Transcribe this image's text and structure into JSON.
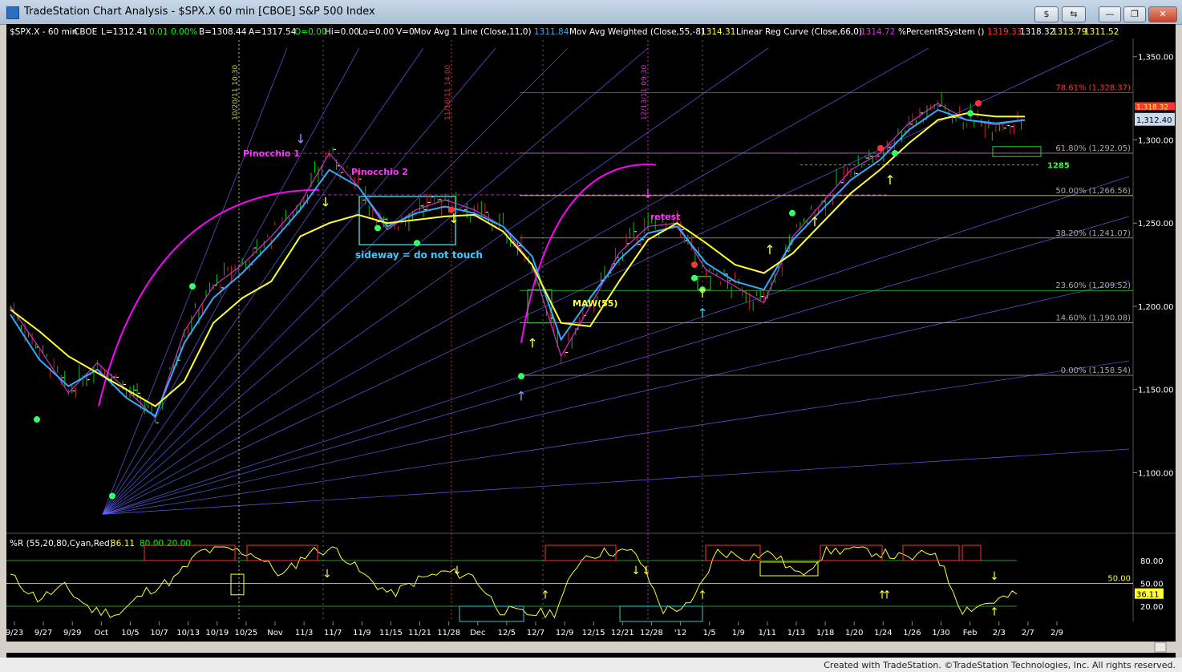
{
  "window": {
    "title": "TradeStation Chart Analysis - $SPX.X 60 min [CBOE] S&P 500 Index",
    "buttons": [
      "$",
      "⇆",
      "—",
      "❐",
      "✕"
    ]
  },
  "header": {
    "symbol": "$SPX.X - 60 min",
    "exchange": "CBOE",
    "last": "L=1312.41",
    "change": "0.01",
    "pct": "0.00%",
    "bid": "B=1308.44",
    "ask": "A=1317.54",
    "open": "O=0.00",
    "hi": "Hi=0.00",
    "lo": "Lo=0.00",
    "vol": "V=0",
    "ind1": "Mov Avg 1 Line (Close,11,0)",
    "ind1_val": "1311.84",
    "ind2": "Mov Avg Weighted (Close,55,-8)",
    "ind2_val": "1314.31",
    "ind3": "Linear Reg Curve (Close,66,0)",
    "ind3_val": "1314.72",
    "ind4": "%PercentRSystem ()",
    "ind4_v1": "1319.33",
    "ind4_v2": "1318.32",
    "ind4_v3": "1313.79",
    "ind4_v4": "1311.52"
  },
  "colors": {
    "background": "#000000",
    "price_bars": "#00c800",
    "ma11": "#33a8ff",
    "maw55": "#ffff33",
    "linreg": "#cc33cc",
    "arc": "#ff00ff",
    "fan": "#6666ff",
    "fib": "#aaaaaa",
    "fib_label": "#aaaaaa",
    "red_level": "#ff3333",
    "cyan": "#33cccc",
    "osc_line": "#ffff33",
    "osc_high": "#ff3333",
    "osc_low": "#33cccc"
  },
  "chart_data": {
    "type": "line",
    "title": "$SPX.X 60 min [CBOE] S&P 500 Index",
    "x": [
      "9/23",
      "9/27",
      "9/29",
      "Oct",
      "10/5",
      "10/7",
      "10/13",
      "10/19",
      "10/25",
      "Nov",
      "11/3",
      "11/7",
      "11/9",
      "11/15",
      "11/21",
      "11/28",
      "Dec",
      "12/5",
      "12/7",
      "12/9",
      "12/15",
      "12/21",
      "12/28",
      "'12",
      "1/5",
      "1/9",
      "1/11",
      "1/13",
      "1/18",
      "1/20",
      "1/24",
      "1/26",
      "1/30",
      "Feb"
    ],
    "x_ticks": [
      "9/23",
      "9/27",
      "9/29",
      "Oct",
      "10/5",
      "10/7",
      "10/13",
      "10/19",
      "10/25",
      "Nov",
      "11/3",
      "11/7",
      "11/9",
      "11/15",
      "11/21",
      "11/28",
      "Dec",
      "12/5",
      "12/7",
      "12/9",
      "12/15",
      "12/21",
      "12/28",
      "'12",
      "1/5",
      "1/9",
      "1/11",
      "1/13",
      "1/18",
      "1/20",
      "1/24",
      "1/26",
      "1/30",
      "Feb",
      "2/3",
      "2/7",
      "2/9"
    ],
    "y_ticks": [
      "1,350.00",
      "1,300.00",
      "1,250.00",
      "1,200.00",
      "1,150.00",
      "1,100.00"
    ],
    "y_tick_values": [
      1350,
      1300,
      1250,
      1200,
      1150,
      1100
    ],
    "ylim": [
      1066,
      1360
    ],
    "series": [
      {
        "values": [
          1200,
          1175,
          1148,
          1166,
          1150,
          1133,
          1185,
          1212,
          1225,
          1242,
          1262,
          1292,
          1272,
          1246,
          1258,
          1264,
          1258,
          1248,
          1225,
          1170,
          1200,
          1232,
          1248,
          1250,
          1222,
          1212,
          1202,
          1242,
          1262,
          1282,
          1292,
          1310,
          1322,
          1312,
          1309,
          1312
        ]
      },
      {
        "values": [
          1195,
          1168,
          1152,
          1162,
          1145,
          1134,
          1178,
          1205,
          1220,
          1238,
          1258,
          1282,
          1272,
          1248,
          1256,
          1260,
          1256,
          1248,
          1230,
          1180,
          1205,
          1228,
          1244,
          1248,
          1226,
          1215,
          1210,
          1240,
          1258,
          1276,
          1288,
          1306,
          1318,
          1312,
          1310,
          1312
        ]
      },
      {
        "values": [
          1198,
          1185,
          1170,
          1160,
          1150,
          1140,
          1155,
          1190,
          1205,
          1215,
          1242,
          1250,
          1255,
          1250,
          1252,
          1254,
          1255,
          1245,
          1225,
          1190,
          1188,
          1215,
          1240,
          1250,
          1238,
          1225,
          1220,
          1232,
          1250,
          1268,
          1282,
          1298,
          1312,
          1316,
          1314,
          1314
        ]
      }
    ],
    "price_last": "1,312.40",
    "price_marker2": "1,318.32",
    "fib_levels": [
      {
        "label": "78.61% (1,328.37)",
        "value": 1328.37
      },
      {
        "label": "61.80% (1,292.05)",
        "value": 1292.05
      },
      {
        "label": "50.00% (1,266.56)",
        "value": 1266.56
      },
      {
        "label": "38.20% (1,241.07)",
        "value": 1241.07
      },
      {
        "label": "23.60% (1,209.52)",
        "value": 1209.52
      },
      {
        "label": "14.60% (1,190.08)",
        "value": 1190.08
      },
      {
        "label": "0.00% (1,158.54)",
        "value": 1158.54
      }
    ],
    "level_1285": {
      "label": "1285",
      "value": 1285
    },
    "vertical_dates": [
      "10/20/11 10:30",
      "11/16/11 14:00",
      "12/13/11 09:30"
    ],
    "annotations": [
      "Pinocchio 1",
      "Pinocchio 2",
      "sideway = do not touch",
      "retest",
      "MAW(55)"
    ],
    "oscillator": {
      "title": "%R (55,20,80,Cyan,Red)",
      "value": "36.11",
      "upper": "80.00",
      "lower": "20.00",
      "current_label": "36.11",
      "mid_label": "50.00",
      "y_ticks": [
        "80.00",
        "50.00",
        "20.00"
      ],
      "ylim": [
        0,
        100
      ],
      "values": [
        60,
        30,
        45,
        15,
        10,
        40,
        55,
        92,
        95,
        88,
        60,
        92,
        95,
        60,
        35,
        55,
        65,
        60,
        15,
        10,
        12,
        85,
        92,
        90,
        15,
        20,
        92,
        85,
        90,
        60,
        92,
        95,
        90,
        82,
        92,
        15,
        25,
        36
      ]
    }
  },
  "footer": {
    "text": "Created with TradeStation. ©TradeStation Technologies, Inc. All rights reserved."
  }
}
